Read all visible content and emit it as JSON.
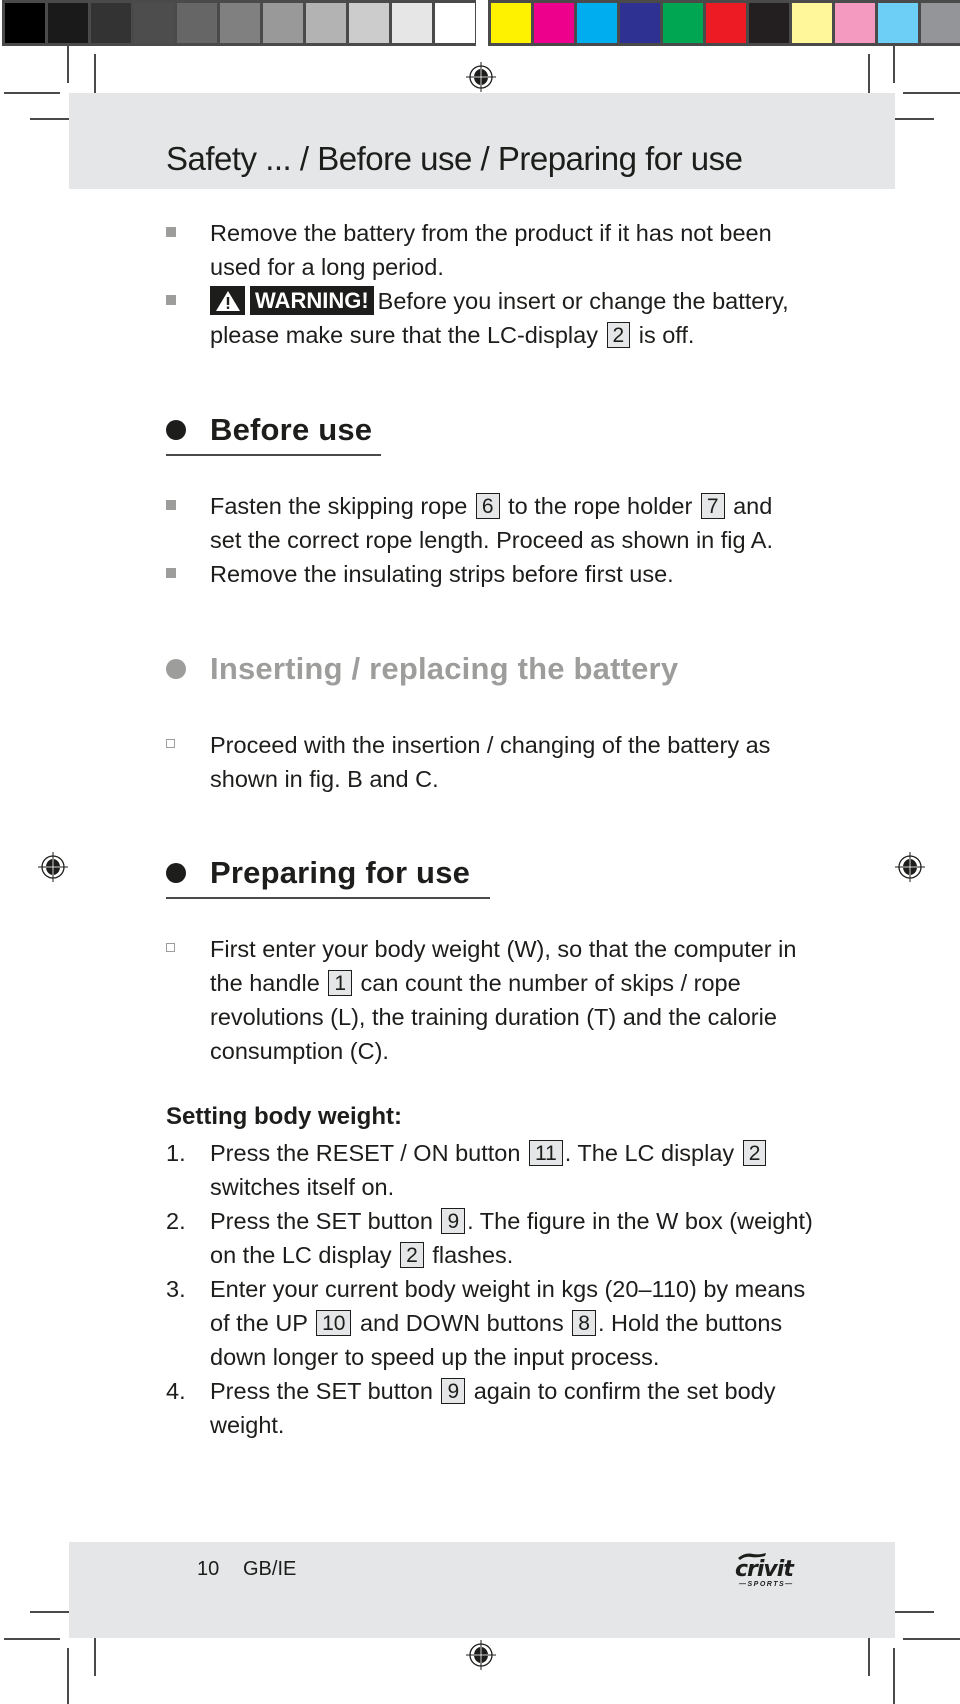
{
  "print_marks": {
    "gray_swatches": [
      "#000000",
      "#1a1a1a",
      "#333333",
      "#4d4d4d",
      "#666666",
      "#808080",
      "#999999",
      "#b3b3b3",
      "#cccccc",
      "#e6e6e6",
      "#ffffff"
    ],
    "color_swatches": [
      "#fff200",
      "#ec008c",
      "#00aeef",
      "#2e3192",
      "#00a651",
      "#ed1c24",
      "#231f20",
      "#fff799",
      "#f49ac1",
      "#6dcff6",
      "#939598"
    ]
  },
  "header": {
    "title": "Safety ... / Before use / Preparing for use"
  },
  "safety_list": [
    {
      "text": "Remove the battery from the product if it has not been used for a long period."
    },
    {
      "warning_label": "WARNING!",
      "text_before": "Before you insert or change the battery, please make sure that the LC-display",
      "ref": "2",
      "text_after": "is off."
    }
  ],
  "sections": {
    "before_use": {
      "title": "Before use",
      "items": [
        {
          "part1": "Fasten the skipping rope",
          "ref1": "6",
          "part2": "to the rope holder",
          "ref2": "7",
          "part3": "and set the correct rope length. Proceed as shown in fig A."
        },
        {
          "text": "Remove the insulating strips before first use."
        }
      ]
    },
    "battery": {
      "title": "Inserting / replacing the battery",
      "items": [
        {
          "text": "Proceed with the insertion / changing of the battery as shown in fig. B and C."
        }
      ]
    },
    "preparing": {
      "title": "Preparing for use",
      "intro": {
        "part1": "First enter your body weight (W), so that the computer in the handle",
        "ref": "1",
        "part2": "can count the number of skips / rope revolutions (L), the training duration (T) and the calorie consumption (C)."
      },
      "subheading": "Setting body weight:",
      "steps": [
        {
          "num": "1.",
          "part1": "Press the RESET / ON button",
          "ref1": "11",
          "part2": ". The LC display",
          "ref2": "2",
          "part3": "switches itself on."
        },
        {
          "num": "2.",
          "part1": "Press the SET button",
          "ref1": "9",
          "part2": ". The figure in the W box (weight) on the LC display",
          "ref2": "2",
          "part3": "flashes."
        },
        {
          "num": "3.",
          "part1": "Enter your current body weight in kgs (20–110) by means of the UP",
          "ref1": "10",
          "part2": "and DOWN buttons",
          "ref2": "8",
          "part3": ". Hold the buttons down longer to speed up the input process."
        },
        {
          "num": "4.",
          "part1": "Press the SET button",
          "ref1": "9",
          "part2": "again to confirm the set body weight."
        }
      ]
    }
  },
  "footer": {
    "page_number": "10",
    "language": "GB/IE",
    "logo_brand": "crivit",
    "logo_sub": "—SPORTS—"
  }
}
